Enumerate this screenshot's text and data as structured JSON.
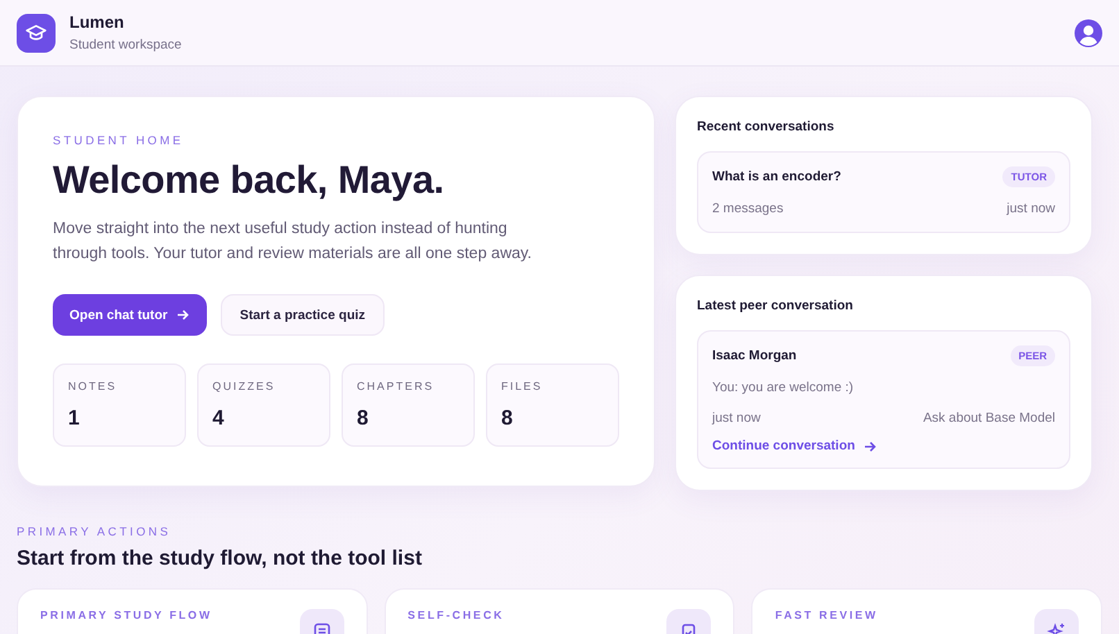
{
  "app": {
    "name": "Lumen",
    "subtitle": "Student workspace"
  },
  "hero": {
    "eyebrow": "STUDENT HOME",
    "title": "Welcome back, Maya.",
    "text": "Move straight into the next useful study action instead of hunting through tools. Your tutor and review materials are all one step away.",
    "primary_button": "Open chat tutor",
    "secondary_button": "Start a practice quiz",
    "stats": [
      {
        "label": "NOTES",
        "value": "1"
      },
      {
        "label": "QUIZZES",
        "value": "4"
      },
      {
        "label": "CHAPTERS",
        "value": "8"
      },
      {
        "label": "FILES",
        "value": "8"
      }
    ]
  },
  "recent": {
    "title": "Recent conversations",
    "items": [
      {
        "title": "What is an encoder?",
        "tag": "TUTOR",
        "meta": "2 messages",
        "time": "just now"
      }
    ]
  },
  "peer": {
    "title": "Latest peer conversation",
    "name": "Isaac Morgan",
    "tag": "PEER",
    "message": "You: you are welcome :)",
    "time": "just now",
    "topic": "Ask about Base Model",
    "link": "Continue conversation"
  },
  "actions": {
    "eyebrow": "PRIMARY ACTIONS",
    "title": "Start from the study flow, not the tool list",
    "cards": [
      {
        "label": "PRIMARY STUDY FLOW",
        "kind": "notes"
      },
      {
        "label": "SELF-CHECK",
        "kind": "check"
      },
      {
        "label": "FAST REVIEW",
        "kind": "sparkle"
      }
    ]
  }
}
